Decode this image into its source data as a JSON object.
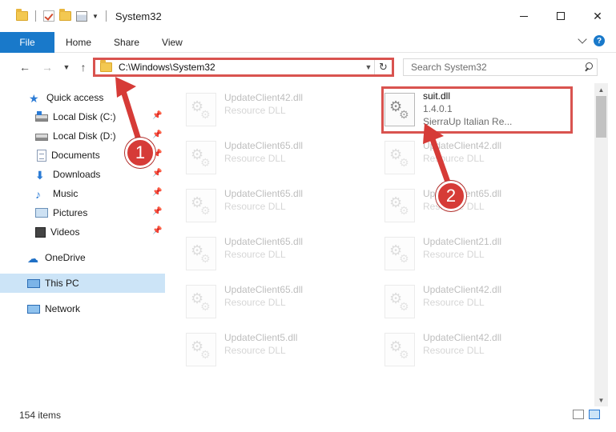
{
  "window": {
    "title": "System32"
  },
  "ribbon": {
    "tabs": [
      "File",
      "Home",
      "Share",
      "View"
    ],
    "help": "?"
  },
  "address": {
    "path": "C:\\Windows\\System32",
    "search_placeholder": "Search System32"
  },
  "nav_pane": {
    "items": [
      {
        "label": "Quick access",
        "icon": "star-icon",
        "pinned": false
      },
      {
        "label": "Local Disk (C:)",
        "icon": "drive-c-icon",
        "pinned": true
      },
      {
        "label": "Local Disk (D:)",
        "icon": "drive-d-icon",
        "pinned": true
      },
      {
        "label": "Documents",
        "icon": "documents-icon",
        "pinned": true
      },
      {
        "label": "Downloads",
        "icon": "downloads-icon",
        "pinned": true
      },
      {
        "label": "Music",
        "icon": "music-icon",
        "pinned": true
      },
      {
        "label": "Pictures",
        "icon": "pictures-icon",
        "pinned": true
      },
      {
        "label": "Videos",
        "icon": "videos-icon",
        "pinned": true
      },
      {
        "label": "OneDrive",
        "icon": "onedrive-icon",
        "pinned": false
      },
      {
        "label": "This PC",
        "icon": "this-pc-icon",
        "pinned": false,
        "selected": true
      },
      {
        "label": "Network",
        "icon": "network-icon",
        "pinned": false
      }
    ]
  },
  "files": [
    {
      "name": "UpdateClient42.dll",
      "type": "Resource DLL",
      "faded": true
    },
    {
      "name": "suit.dll",
      "version": "1.4.0.1",
      "type": "SierraUp Italian Re...",
      "faded": false,
      "highlighted": true
    },
    {
      "name": "UpdateClient65.dll",
      "type": "Resource DLL",
      "faded": true
    },
    {
      "name": "UpdateClient42.dll",
      "type": "Resource DLL",
      "faded": true
    },
    {
      "name": "UpdateClient65.dll",
      "type": "Resource DLL",
      "faded": true
    },
    {
      "name": "UpdateClient65.dll",
      "type": "Resource DLL",
      "faded": true
    },
    {
      "name": "UpdateClient65.dll",
      "type": "Resource DLL",
      "faded": true
    },
    {
      "name": "UpdateClient21.dll",
      "type": "Resource DLL",
      "faded": true
    },
    {
      "name": "UpdateClient65.dll",
      "type": "Resource DLL",
      "faded": true
    },
    {
      "name": "UpdateClient42.dll",
      "type": "Resource DLL",
      "faded": true
    },
    {
      "name": "UpdateClient5.dll",
      "type": "Resource DLL",
      "faded": true
    },
    {
      "name": "UpdateClient42.dll",
      "type": "Resource DLL",
      "faded": true
    }
  ],
  "status": {
    "item_count": "154 items"
  },
  "annotations": {
    "badge_1": "1",
    "badge_2": "2",
    "color": "#d63b37"
  }
}
